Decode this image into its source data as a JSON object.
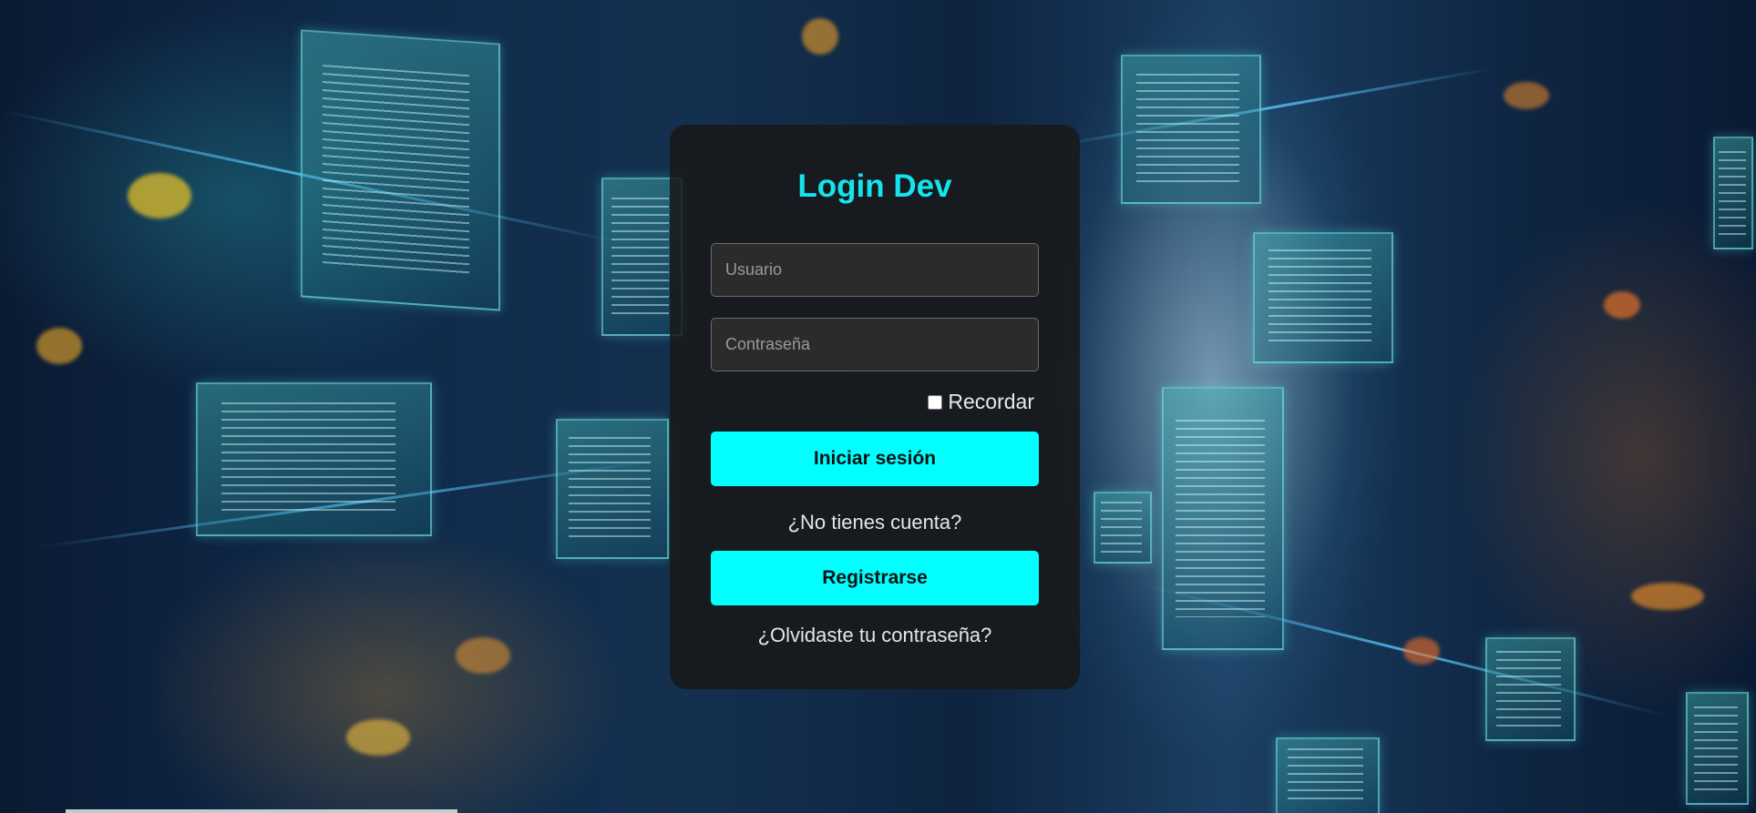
{
  "login": {
    "title": "Login Dev",
    "username_placeholder": "Usuario",
    "password_placeholder": "Contraseña",
    "remember_label": "Recordar",
    "login_button": "Iniciar sesión",
    "no_account_text": "¿No tienes cuenta?",
    "register_button": "Registrarse",
    "forgot_password": "¿Olvidaste tu contraseña?"
  },
  "colors": {
    "accent": "#00ffff",
    "title": "#14e4ee",
    "card_background": "#191919"
  }
}
